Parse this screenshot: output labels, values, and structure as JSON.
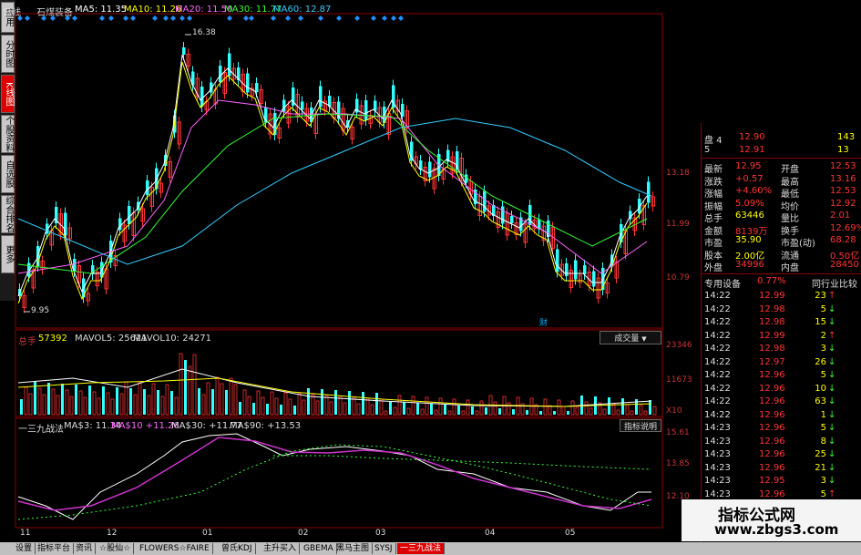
{
  "header": {
    "period": "日线",
    "stock_name": "石煤装备",
    "ma5": "MA5: 11.35",
    "ma10": "MA10: 11.26",
    "ma20": "MA20: 11.50",
    "ma30": "MA30: 11.77",
    "ma60": "MA60: 12.87"
  },
  "left_tabs": [
    {
      "label": "应用",
      "active": false
    },
    {
      "label": "分时图",
      "active": false
    },
    {
      "label": "K线图",
      "active": true
    },
    {
      "label": "个股资料",
      "active": false
    },
    {
      "label": "自选股",
      "active": false
    },
    {
      "label": "综合排名",
      "active": false
    },
    {
      "label": "更多",
      "active": false
    }
  ],
  "price_chart": {
    "high_marker": "16.38",
    "low_marker": "9.95",
    "axis_labels": [
      "13.18",
      "11.99",
      "10.79"
    ],
    "note_marker": "财"
  },
  "volume_panel": {
    "title": "总手",
    "total": "57392",
    "mavol5": "MAVOL5: 25621",
    "mavol10": "MAVOL10: 24271",
    "dropdown": "成交量",
    "axis_labels": [
      "23346",
      "11673",
      "X10"
    ]
  },
  "indicator_panel": {
    "title": "一三九战法",
    "ma3": "MA$3: 11.34",
    "ma10": "MA$10 +11.26",
    "ma30": "MA$30: +11.77",
    "ma90": "MA$90: +13.53",
    "button": "指标说明",
    "axis_labels": [
      "15.61",
      "13.85",
      "12.10"
    ]
  },
  "x_axis": [
    "11",
    "12",
    "01",
    "02",
    "03",
    "04",
    "05"
  ],
  "quote_panel": {
    "top_rows": [
      {
        "label": "盘 4",
        "price": "12.90",
        "vol": "143"
      },
      {
        "label": "5",
        "price": "12.91",
        "vol": "13"
      }
    ],
    "rows": [
      {
        "l1": "最新",
        "v1": "12.95",
        "l2": "开盘",
        "v2": "12.53"
      },
      {
        "l1": "涨跌",
        "v1": "+0.57",
        "l2": "最高",
        "v2": "13.16"
      },
      {
        "l1": "涨幅",
        "v1": "+4.60%",
        "l2": "最低",
        "v2": "12.53"
      },
      {
        "l1": "振幅",
        "v1": "5.09%",
        "l2": "均价",
        "v2": "12.92"
      },
      {
        "l1": "总手",
        "v1": "63446",
        "l2": "量比",
        "v2": "2.01"
      },
      {
        "l1": "金额",
        "v1": "8139万",
        "l2": "换手",
        "v2": "12.69%"
      },
      {
        "l1": "市盈",
        "v1": "35.90",
        "l2": "市盈(动)",
        "v2": "68.28"
      },
      {
        "l1": "股本",
        "v1": "2.00亿",
        "l2": "流通",
        "v2": "0.50亿"
      },
      {
        "l1": "外盘",
        "v1": "34996",
        "l2": "内盘",
        "v2": "28450"
      }
    ],
    "sector_label": "专用设备",
    "sector_change": "0.77%",
    "compare_label": "同行业比较"
  },
  "ticks": [
    {
      "time": "14:22",
      "price": "12.99",
      "vol": "23",
      "dir": "up"
    },
    {
      "time": "14:22",
      "price": "12.98",
      "vol": "5",
      "dir": "down"
    },
    {
      "time": "14:22",
      "price": "12.98",
      "vol": "15",
      "dir": "down"
    },
    {
      "time": "14:22",
      "price": "12.99",
      "vol": "2",
      "dir": "up"
    },
    {
      "time": "14:22",
      "price": "12.98",
      "vol": "3",
      "dir": "down"
    },
    {
      "time": "14:22",
      "price": "12.97",
      "vol": "26",
      "dir": "down"
    },
    {
      "time": "14:22",
      "price": "12.96",
      "vol": "5",
      "dir": "down"
    },
    {
      "time": "14:22",
      "price": "12.96",
      "vol": "10",
      "dir": "down"
    },
    {
      "time": "14:22",
      "price": "12.96",
      "vol": "63",
      "dir": "down"
    },
    {
      "time": "14:22",
      "price": "12.96",
      "vol": "1",
      "dir": "down"
    },
    {
      "time": "14:23",
      "price": "12.96",
      "vol": "5",
      "dir": "down"
    },
    {
      "time": "14:23",
      "price": "12.96",
      "vol": "8",
      "dir": "down"
    },
    {
      "time": "14:23",
      "price": "12.96",
      "vol": "25",
      "dir": "down"
    },
    {
      "time": "14:23",
      "price": "12.96",
      "vol": "21",
      "dir": "down"
    },
    {
      "time": "14:23",
      "price": "12.95",
      "vol": "3",
      "dir": "down"
    },
    {
      "time": "14:23",
      "price": "12.96",
      "vol": "5",
      "dir": "up"
    },
    {
      "time": "14:23",
      "price": "12.96",
      "vol": "2",
      "dir": "up"
    }
  ],
  "bottom_tabs": [
    {
      "label": "设置",
      "active": false
    },
    {
      "label": "指标平台",
      "active": false
    },
    {
      "label": "资讯",
      "active": false
    },
    {
      "label": "☆股仙☆",
      "active": false
    },
    {
      "label": "FLOWERS☆FAIRE",
      "active": false
    },
    {
      "label": "曾氏KDJ",
      "active": false
    },
    {
      "label": "主升买入",
      "active": false
    },
    {
      "label": "GBEMA",
      "active": false
    },
    {
      "label": "黑马主图",
      "active": false
    },
    {
      "label": "SYSJ",
      "active": false
    },
    {
      "label": "一三九战法",
      "active": true
    }
  ],
  "watermark": {
    "line1": "指标公式网",
    "line2": "www.zbgs3.com"
  },
  "colors": {
    "up": "#ff3333",
    "down": "#33ffff",
    "ma5": "#ffffff",
    "ma10": "#ffff00",
    "ma20": "#ff66ff",
    "ma30": "#33ff33",
    "ma60": "#33ccff"
  }
}
